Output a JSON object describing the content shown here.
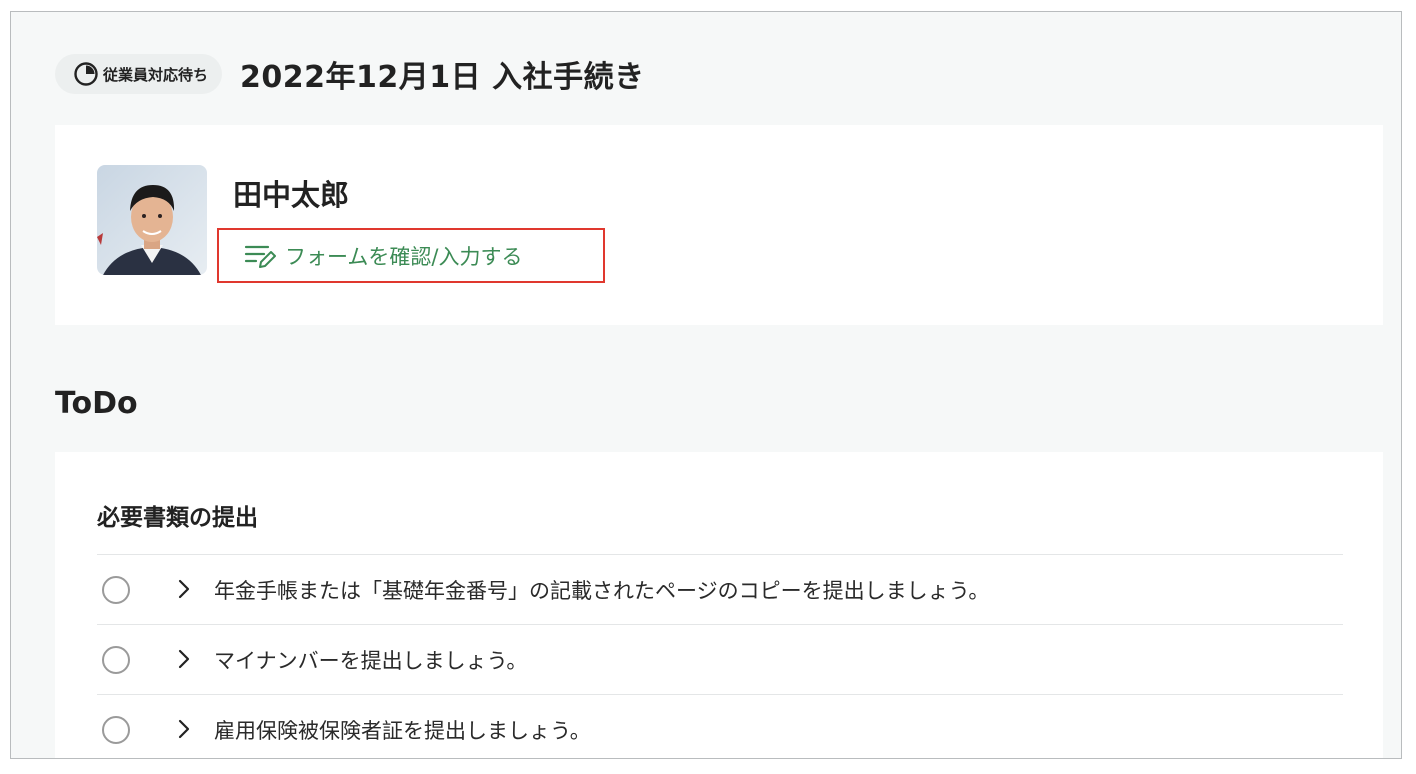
{
  "header": {
    "status_label": "従業員対応待ち",
    "title": "2022年12月1日 入社手続き"
  },
  "employee": {
    "name": "田中太郎",
    "form_link_label": "フォームを確認/入力する"
  },
  "todo": {
    "heading": "ToDo",
    "section_title": "必要書類の提出",
    "items": [
      {
        "text": "年金手帳または「基礎年金番号」の記載されたページのコピーを提出しましょう。"
      },
      {
        "text": "マイナンバーを提出しましょう。"
      },
      {
        "text": "雇用保険被保険者証を提出しましょう。"
      }
    ]
  },
  "colors": {
    "accent_green": "#3c8b55",
    "highlight_red": "#e0382e",
    "background": "#f6f8f8"
  },
  "icons": {
    "status": "pie-progress-icon",
    "form_link": "edit-list-icon",
    "item_check": "circle-check-icon",
    "item_expand": "chevron-right-icon"
  }
}
